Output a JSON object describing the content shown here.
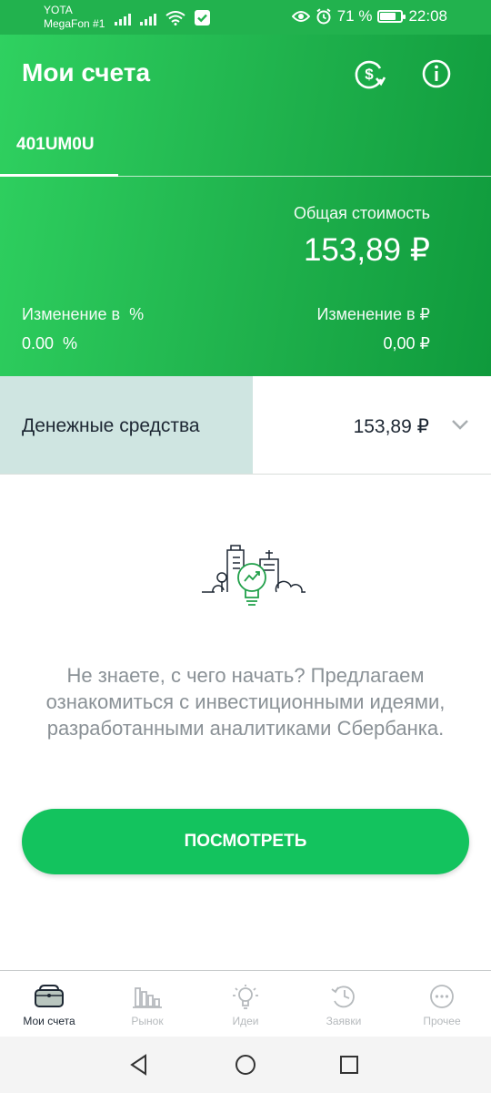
{
  "status_bar": {
    "carrier_1": "YOTA",
    "carrier_2": "MegaFon #1",
    "battery_text": "71 %",
    "battery_level": 0.71,
    "time": "22:08"
  },
  "header": {
    "title": "Мои счета",
    "icons": [
      "currency-exchange-icon",
      "info-icon"
    ]
  },
  "tabs": [
    {
      "label": "401UM0U",
      "active": true
    }
  ],
  "summary": {
    "total_label": "Общая стоимость",
    "total_value": "153,89 ₽",
    "change_pct_label": "Изменение в  %",
    "change_pct_value": "0.00  %",
    "change_rub_label": "Изменение в ₽",
    "change_rub_value": "0,00 ₽"
  },
  "cash": {
    "label": "Денежные средства",
    "value": "153,89 ₽"
  },
  "promo": {
    "text": "Не знаете, с чего начать? Предлагаем ознакомиться с инвестиционными идеями, разработанными аналитиками Сбербанка.",
    "button_label": "ПОСМОТРЕТЬ"
  },
  "bottom_nav": [
    {
      "label": "Мои счета",
      "icon": "wallet-icon",
      "active": true
    },
    {
      "label": "Рынок",
      "icon": "bar-chart-icon",
      "active": false
    },
    {
      "label": "Идеи",
      "icon": "lightbulb-icon",
      "active": false
    },
    {
      "label": "Заявки",
      "icon": "history-icon",
      "active": false
    },
    {
      "label": "Прочее",
      "icon": "more-icon",
      "active": false
    }
  ],
  "colors": {
    "accent": "#13c35e",
    "header_start": "#2fd160",
    "header_end": "#0f9a3c",
    "cash_highlight": "#cfe5e1",
    "text_dark": "#1d2733",
    "text_muted": "#8a9196"
  }
}
